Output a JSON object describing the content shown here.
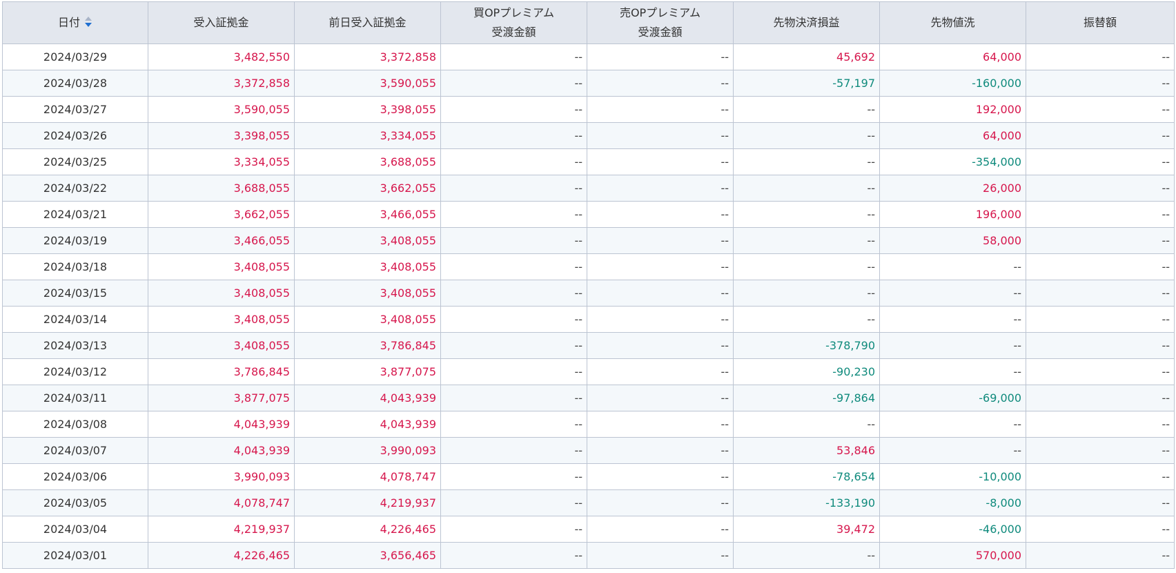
{
  "colors": {
    "positive": "#d6164c",
    "negative": "#0f8a7c",
    "neutral": "#444444",
    "header_bg": "#e3e7ee",
    "row_alt_bg": "#f4f8fb",
    "sort_active": "#1f6fd1",
    "sort_inactive": "#a9b4c8"
  },
  "table": {
    "sort": {
      "column": "date",
      "direction": "descending",
      "icon": "sort-desc-icon"
    },
    "headers": [
      {
        "key": "date",
        "lines": [
          "日付"
        ]
      },
      {
        "key": "margin",
        "lines": [
          "受入証拠金"
        ]
      },
      {
        "key": "prev_margin",
        "lines": [
          "前日受入証拠金"
        ]
      },
      {
        "key": "buy_op",
        "lines": [
          "買OPプレミアム",
          "受渡金額"
        ]
      },
      {
        "key": "sell_op",
        "lines": [
          "売OPプレミアム",
          "受渡金額"
        ]
      },
      {
        "key": "futures_pl",
        "lines": [
          "先物決済損益"
        ]
      },
      {
        "key": "futures_mark",
        "lines": [
          "先物値洗"
        ]
      },
      {
        "key": "transfer",
        "lines": [
          "振替額"
        ]
      }
    ],
    "rows": [
      {
        "date": "2024/03/29",
        "margin": "3,482,550",
        "prev_margin": "3,372,858",
        "buy_op": "--",
        "sell_op": "--",
        "futures_pl": "45,692",
        "futures_mark": "64,000",
        "transfer": "--"
      },
      {
        "date": "2024/03/28",
        "margin": "3,372,858",
        "prev_margin": "3,590,055",
        "buy_op": "--",
        "sell_op": "--",
        "futures_pl": "-57,197",
        "futures_mark": "-160,000",
        "transfer": "--"
      },
      {
        "date": "2024/03/27",
        "margin": "3,590,055",
        "prev_margin": "3,398,055",
        "buy_op": "--",
        "sell_op": "--",
        "futures_pl": "--",
        "futures_mark": "192,000",
        "transfer": "--"
      },
      {
        "date": "2024/03/26",
        "margin": "3,398,055",
        "prev_margin": "3,334,055",
        "buy_op": "--",
        "sell_op": "--",
        "futures_pl": "--",
        "futures_mark": "64,000",
        "transfer": "--"
      },
      {
        "date": "2024/03/25",
        "margin": "3,334,055",
        "prev_margin": "3,688,055",
        "buy_op": "--",
        "sell_op": "--",
        "futures_pl": "--",
        "futures_mark": "-354,000",
        "transfer": "--"
      },
      {
        "date": "2024/03/22",
        "margin": "3,688,055",
        "prev_margin": "3,662,055",
        "buy_op": "--",
        "sell_op": "--",
        "futures_pl": "--",
        "futures_mark": "26,000",
        "transfer": "--"
      },
      {
        "date": "2024/03/21",
        "margin": "3,662,055",
        "prev_margin": "3,466,055",
        "buy_op": "--",
        "sell_op": "--",
        "futures_pl": "--",
        "futures_mark": "196,000",
        "transfer": "--"
      },
      {
        "date": "2024/03/19",
        "margin": "3,466,055",
        "prev_margin": "3,408,055",
        "buy_op": "--",
        "sell_op": "--",
        "futures_pl": "--",
        "futures_mark": "58,000",
        "transfer": "--"
      },
      {
        "date": "2024/03/18",
        "margin": "3,408,055",
        "prev_margin": "3,408,055",
        "buy_op": "--",
        "sell_op": "--",
        "futures_pl": "--",
        "futures_mark": "--",
        "transfer": "--"
      },
      {
        "date": "2024/03/15",
        "margin": "3,408,055",
        "prev_margin": "3,408,055",
        "buy_op": "--",
        "sell_op": "--",
        "futures_pl": "--",
        "futures_mark": "--",
        "transfer": "--"
      },
      {
        "date": "2024/03/14",
        "margin": "3,408,055",
        "prev_margin": "3,408,055",
        "buy_op": "--",
        "sell_op": "--",
        "futures_pl": "--",
        "futures_mark": "--",
        "transfer": "--"
      },
      {
        "date": "2024/03/13",
        "margin": "3,408,055",
        "prev_margin": "3,786,845",
        "buy_op": "--",
        "sell_op": "--",
        "futures_pl": "-378,790",
        "futures_mark": "--",
        "transfer": "--"
      },
      {
        "date": "2024/03/12",
        "margin": "3,786,845",
        "prev_margin": "3,877,075",
        "buy_op": "--",
        "sell_op": "--",
        "futures_pl": "-90,230",
        "futures_mark": "--",
        "transfer": "--"
      },
      {
        "date": "2024/03/11",
        "margin": "3,877,075",
        "prev_margin": "4,043,939",
        "buy_op": "--",
        "sell_op": "--",
        "futures_pl": "-97,864",
        "futures_mark": "-69,000",
        "transfer": "--"
      },
      {
        "date": "2024/03/08",
        "margin": "4,043,939",
        "prev_margin": "4,043,939",
        "buy_op": "--",
        "sell_op": "--",
        "futures_pl": "--",
        "futures_mark": "--",
        "transfer": "--"
      },
      {
        "date": "2024/03/07",
        "margin": "4,043,939",
        "prev_margin": "3,990,093",
        "buy_op": "--",
        "sell_op": "--",
        "futures_pl": "53,846",
        "futures_mark": "--",
        "transfer": "--"
      },
      {
        "date": "2024/03/06",
        "margin": "3,990,093",
        "prev_margin": "4,078,747",
        "buy_op": "--",
        "sell_op": "--",
        "futures_pl": "-78,654",
        "futures_mark": "-10,000",
        "transfer": "--"
      },
      {
        "date": "2024/03/05",
        "margin": "4,078,747",
        "prev_margin": "4,219,937",
        "buy_op": "--",
        "sell_op": "--",
        "futures_pl": "-133,190",
        "futures_mark": "-8,000",
        "transfer": "--"
      },
      {
        "date": "2024/03/04",
        "margin": "4,219,937",
        "prev_margin": "4,226,465",
        "buy_op": "--",
        "sell_op": "--",
        "futures_pl": "39,472",
        "futures_mark": "-46,000",
        "transfer": "--"
      },
      {
        "date": "2024/03/01",
        "margin": "4,226,465",
        "prev_margin": "3,656,465",
        "buy_op": "--",
        "sell_op": "--",
        "futures_pl": "--",
        "futures_mark": "570,000",
        "transfer": "--"
      }
    ]
  }
}
